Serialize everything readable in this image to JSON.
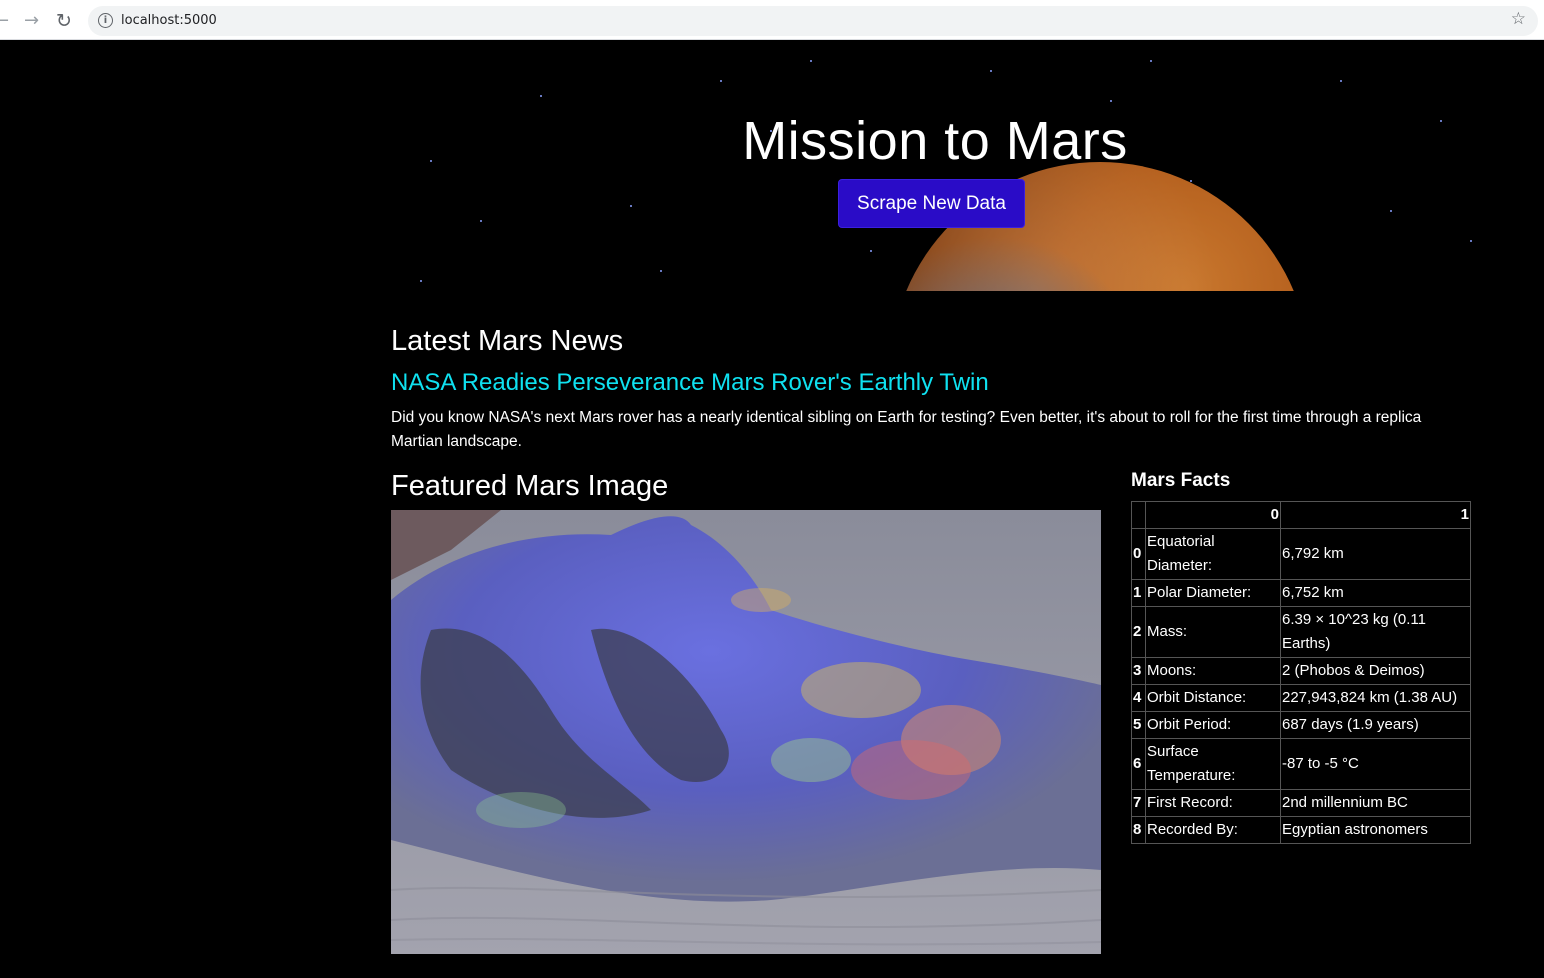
{
  "browser": {
    "url": "localhost:5000",
    "info_icon": "info-icon",
    "star_icon": "bookmark-star-icon"
  },
  "hero": {
    "title": "Mission to Mars",
    "button_label": "Scrape New Data"
  },
  "news": {
    "heading": "Latest Mars News",
    "title": "NASA Readies Perseverance Mars Rover's Earthly Twin",
    "paragraph": "Did you know NASA's next Mars rover has a nearly identical sibling on Earth for testing? Even better, it's about to roll for the first time through a replica Martian landscape."
  },
  "featured": {
    "heading": "Featured Mars Image"
  },
  "facts": {
    "heading": "Mars Facts",
    "columns": [
      "",
      "0",
      "1"
    ],
    "rows": [
      {
        "index": "0",
        "label": "Equatorial Diameter:",
        "value": "6,792 km"
      },
      {
        "index": "1",
        "label": "Polar Diameter:",
        "value": "6,752 km"
      },
      {
        "index": "2",
        "label": "Mass:",
        "value": "6.39 × 10^23 kg (0.11 Earths)"
      },
      {
        "index": "3",
        "label": "Moons:",
        "value": "2 (Phobos & Deimos)"
      },
      {
        "index": "4",
        "label": "Orbit Distance:",
        "value": "227,943,824 km (1.38 AU)"
      },
      {
        "index": "5",
        "label": "Orbit Period:",
        "value": "687 days (1.9 years)"
      },
      {
        "index": "6",
        "label": "Surface Temperature:",
        "value": "-87 to -5 °C"
      },
      {
        "index": "7",
        "label": "First Record:",
        "value": "2nd millennium BC"
      },
      {
        "index": "8",
        "label": "Recorded By:",
        "value": "Egyptian astronomers"
      }
    ]
  },
  "colors": {
    "button_bg": "#2a0cc7",
    "news_title": "#0fe1f0",
    "page_bg": "#000000"
  }
}
